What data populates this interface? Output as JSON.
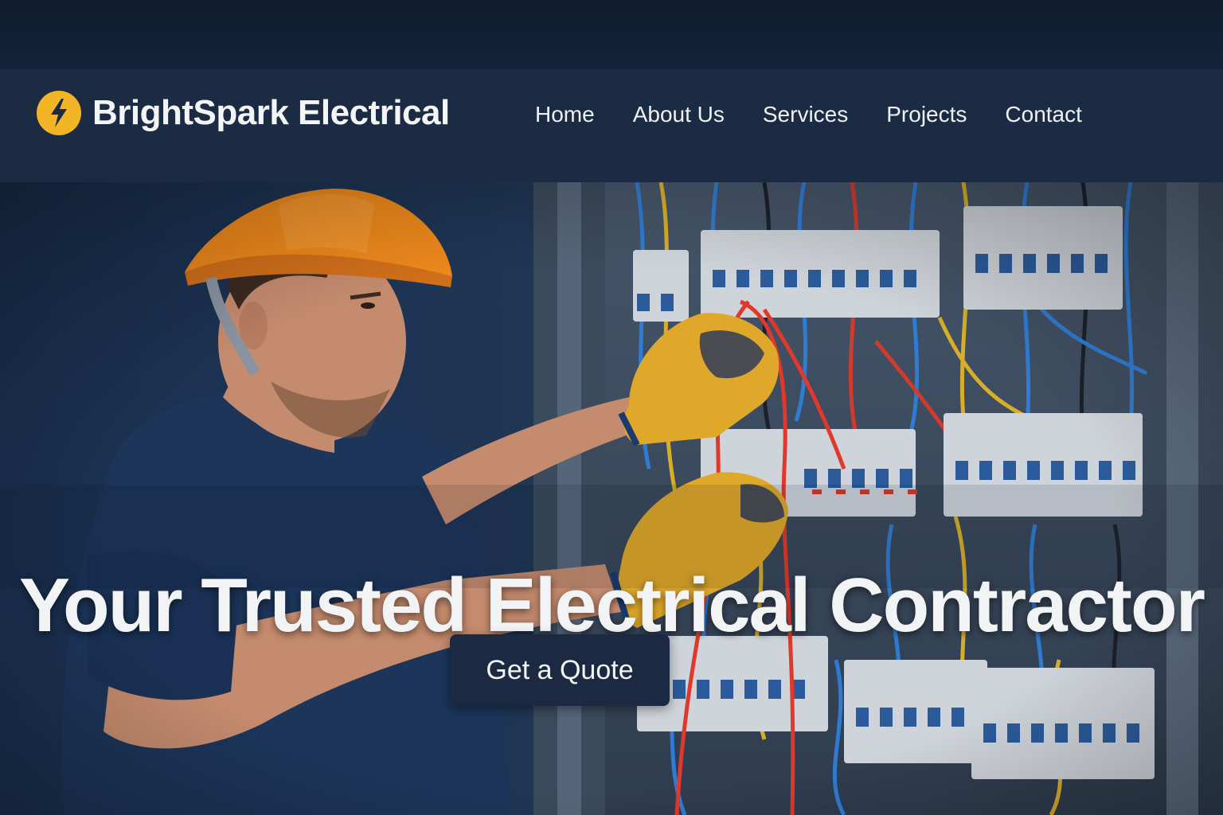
{
  "brand": {
    "name": "BrightSpark Electrical",
    "icon": "lightning-bolt-icon",
    "icon_color": "#f2b526"
  },
  "nav": {
    "items": [
      {
        "label": "Home"
      },
      {
        "label": "About Us"
      },
      {
        "label": "Services"
      },
      {
        "label": "Projects"
      },
      {
        "label": "Contact"
      }
    ]
  },
  "hero": {
    "title": "Your Trusted Electrical Contractor",
    "cta_label": "Get a Quote",
    "image": "electrician-working-on-breaker-panel"
  },
  "colors": {
    "navbar": "#1b2b44",
    "cta": "#1b2a42",
    "helmet": "#f08a1c",
    "gloves": "#e0a82a",
    "shirt": "#1c3559"
  }
}
